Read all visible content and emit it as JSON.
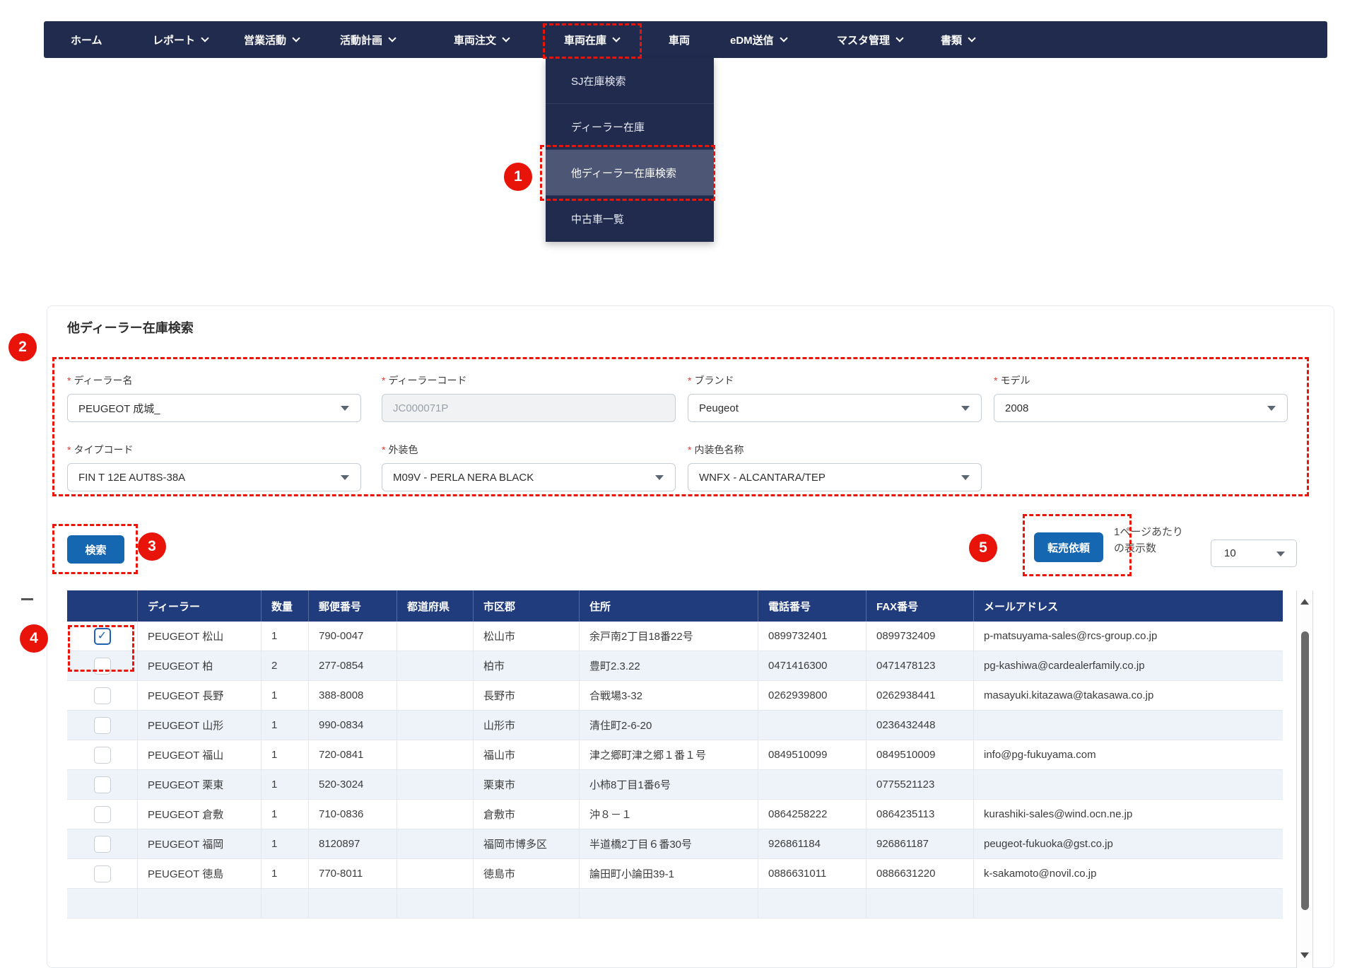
{
  "nav": {
    "items": [
      {
        "label": "ホーム",
        "has_chevron": false
      },
      {
        "label": "レポート",
        "has_chevron": true
      },
      {
        "label": "営業活動",
        "has_chevron": true
      },
      {
        "label": "活動計画",
        "has_chevron": true
      },
      {
        "label": "車両注文",
        "has_chevron": true
      },
      {
        "label": "車両在庫",
        "has_chevron": true,
        "highlighted": true
      },
      {
        "label": "車両",
        "has_chevron": false
      },
      {
        "label": "eDM送信",
        "has_chevron": true
      },
      {
        "label": "マスタ管理",
        "has_chevron": true
      },
      {
        "label": "書類",
        "has_chevron": true
      }
    ]
  },
  "dropdown": {
    "items": [
      {
        "label": "SJ在庫検索",
        "active": false
      },
      {
        "label": "ディーラー在庫",
        "active": false
      },
      {
        "label": "他ディーラー在庫検索",
        "active": true
      },
      {
        "label": "中古車一覧",
        "active": false
      }
    ]
  },
  "annotations": {
    "step1": "1",
    "step2": "2",
    "step3": "3",
    "step4": "4",
    "step5": "5"
  },
  "panel": {
    "title": "他ディーラー在庫検索",
    "required_mark": "*",
    "fields_row1": [
      {
        "label": "ディーラー名",
        "value": "PEUGEOT 成城_",
        "select": true
      },
      {
        "label": "ディーラーコード",
        "value": "JC000071P",
        "disabled": true
      },
      {
        "label": "ブランド",
        "value": "Peugeot",
        "select": true
      },
      {
        "label": "モデル",
        "value": "2008",
        "select": true
      }
    ],
    "fields_row2": [
      {
        "label": "タイプコード",
        "value": "FIN T 12E AUT8S-38A",
        "select": true
      },
      {
        "label": "外装色",
        "value": "M09V - PERLA NERA BLACK",
        "select": true
      },
      {
        "label": "内装色名称",
        "value": "WNFX - ALCANTARA/TEP",
        "select": true
      }
    ],
    "search_button": "検索",
    "resale_button": "転売依頼",
    "per_page_line1": "1ページあたり",
    "per_page_line2": "の表示数",
    "per_page_value": "10"
  },
  "table": {
    "headers": [
      "",
      "ディーラー",
      "数量",
      "郵便番号",
      "都道府県",
      "市区郡",
      "住所",
      "電話番号",
      "FAX番号",
      "メールアドレス"
    ],
    "rows": [
      {
        "checked": true,
        "dealer": "PEUGEOT 松山",
        "qty": "1",
        "zip": "790-0047",
        "pref": "",
        "city": "松山市",
        "address": "余戸南2丁目18番22号",
        "phone": "0899732401",
        "fax": "0899732409",
        "email": "p-matsuyama-sales@rcs-group.co.jp"
      },
      {
        "dealer": "PEUGEOT 柏",
        "qty": "2",
        "zip": "277-0854",
        "pref": "",
        "city": "柏市",
        "address": "豊町2.3.22",
        "phone": "0471416300",
        "fax": "0471478123",
        "email": "pg-kashiwa@cardealerfamily.co.jp"
      },
      {
        "dealer": "PEUGEOT 長野",
        "qty": "1",
        "zip": "388-8008",
        "pref": "",
        "city": "長野市",
        "address": "合戦場3-32",
        "phone": "0262939800",
        "fax": "0262938441",
        "email": "masayuki.kitazawa@takasawa.co.jp"
      },
      {
        "dealer": "PEUGEOT 山形",
        "qty": "1",
        "zip": "990-0834",
        "pref": "",
        "city": "山形市",
        "address": "清住町2-6-20",
        "phone": "",
        "fax": "0236432448",
        "email": ""
      },
      {
        "dealer": "PEUGEOT 福山",
        "qty": "1",
        "zip": "720-0841",
        "pref": "",
        "city": "福山市",
        "address": "津之郷町津之郷１番１号",
        "phone": "0849510099",
        "fax": "0849510009",
        "email": "info@pg-fukuyama.com"
      },
      {
        "dealer": "PEUGEOT 栗東",
        "qty": "1",
        "zip": "520-3024",
        "pref": "",
        "city": "栗東市",
        "address": "小柿8丁目1番6号",
        "phone": "",
        "fax": "0775521123",
        "email": ""
      },
      {
        "dealer": "PEUGEOT 倉敷",
        "qty": "1",
        "zip": "710-0836",
        "pref": "",
        "city": "倉敷市",
        "address": "沖８－１",
        "phone": "0864258222",
        "fax": "0864235113",
        "email": "kurashiki-sales@wind.ocn.ne.jp"
      },
      {
        "dealer": "PEUGEOT 福岡",
        "qty": "1",
        "zip": "8120897",
        "pref": "",
        "city": "福岡市博多区",
        "address": "半道橋2丁目６番30号",
        "phone": "926861184",
        "fax": "926861187",
        "email": "peugeot-fukuoka@gst.co.jp"
      },
      {
        "dealer": "PEUGEOT 徳島",
        "qty": "1",
        "zip": "770-8011",
        "pref": "",
        "city": "徳島市",
        "address": "論田町小論田39-1",
        "phone": "0886631011",
        "fax": "0886631220",
        "email": "k-sakamoto@novil.co.jp"
      },
      {
        "partial": true,
        "dealer": "",
        "qty": "",
        "zip": "",
        "pref": "",
        "city": "",
        "address": "",
        "phone": "",
        "fax": "",
        "email": ""
      }
    ]
  },
  "colors": {
    "nav_bg": "#212b4e",
    "table_header_bg": "#203c7c",
    "button_blue": "#1667b1",
    "annotation_red": "#ea1408",
    "row_alt_bg": "#edf3f9",
    "checkbox_checked_blue": "#1e63b0"
  }
}
